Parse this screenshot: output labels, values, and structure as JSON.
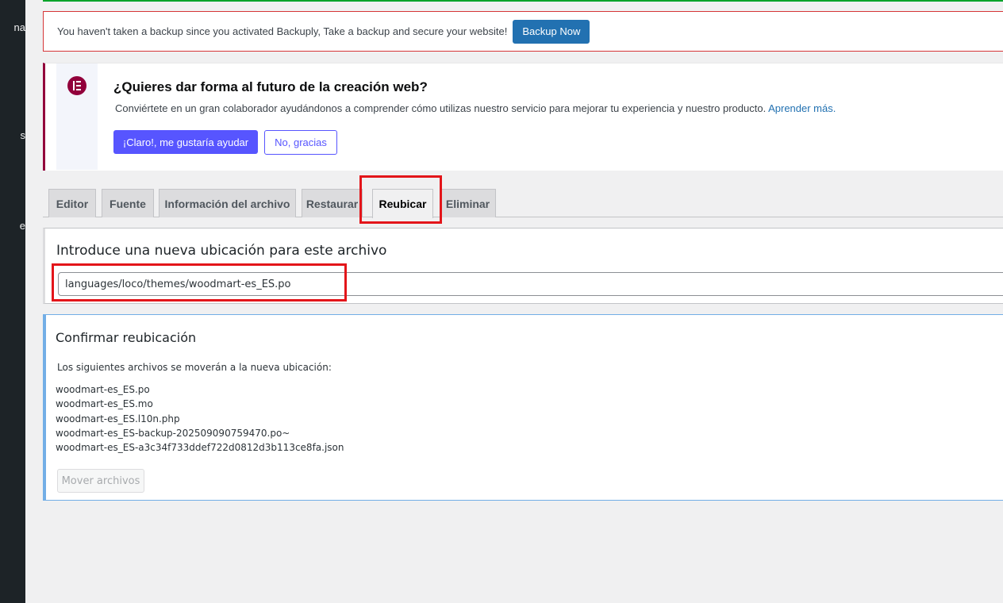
{
  "sidebar": {
    "fragments": [
      "na",
      "s",
      "e"
    ]
  },
  "backup_notice": {
    "message": "You haven't taken a backup since you activated Backuply, Take a backup and secure your website!",
    "button_label": "Backup Now"
  },
  "elementor_notice": {
    "title": "¿Quieres dar forma al futuro de la creación web?",
    "description": "Conviértete en un gran colaborador ayudándonos a comprender cómo utilizas nuestro servicio para mejorar tu experiencia y nuestro producto.",
    "learn_more": "Aprender más.",
    "accept_label": "¡Claro!, me gustaría ayudar",
    "decline_label": "No, gracias"
  },
  "tabs": [
    {
      "label": "Editor",
      "active": false
    },
    {
      "label": "Fuente",
      "active": false
    },
    {
      "label": "Información del archivo",
      "active": false
    },
    {
      "label": "Restaurar",
      "active": false
    },
    {
      "label": "Reubicar",
      "active": true
    },
    {
      "label": "Eliminar",
      "active": false
    }
  ],
  "location_panel": {
    "heading": "Introduce una nueva ubicación para este archivo",
    "path_value": "languages/loco/themes/woodmart-es_ES.po"
  },
  "confirm_panel": {
    "heading": "Confirmar reubicación",
    "subtitle": "Los siguientes archivos se moverán a la nueva ubicación:",
    "files": [
      "woodmart-es_ES.po",
      "woodmart-es_ES.mo",
      "woodmart-es_ES.l10n.php",
      "woodmart-es_ES-backup-202509090759470.po~",
      "woodmart-es_ES-a3c34f733ddef722d0812d3b113ce8fa.json"
    ],
    "button_label": "Mover archivos"
  },
  "colors": {
    "accent": "#2271b1",
    "elementor": "#92003b",
    "elementor_button": "#5755ff",
    "highlight": "#e3151a"
  }
}
